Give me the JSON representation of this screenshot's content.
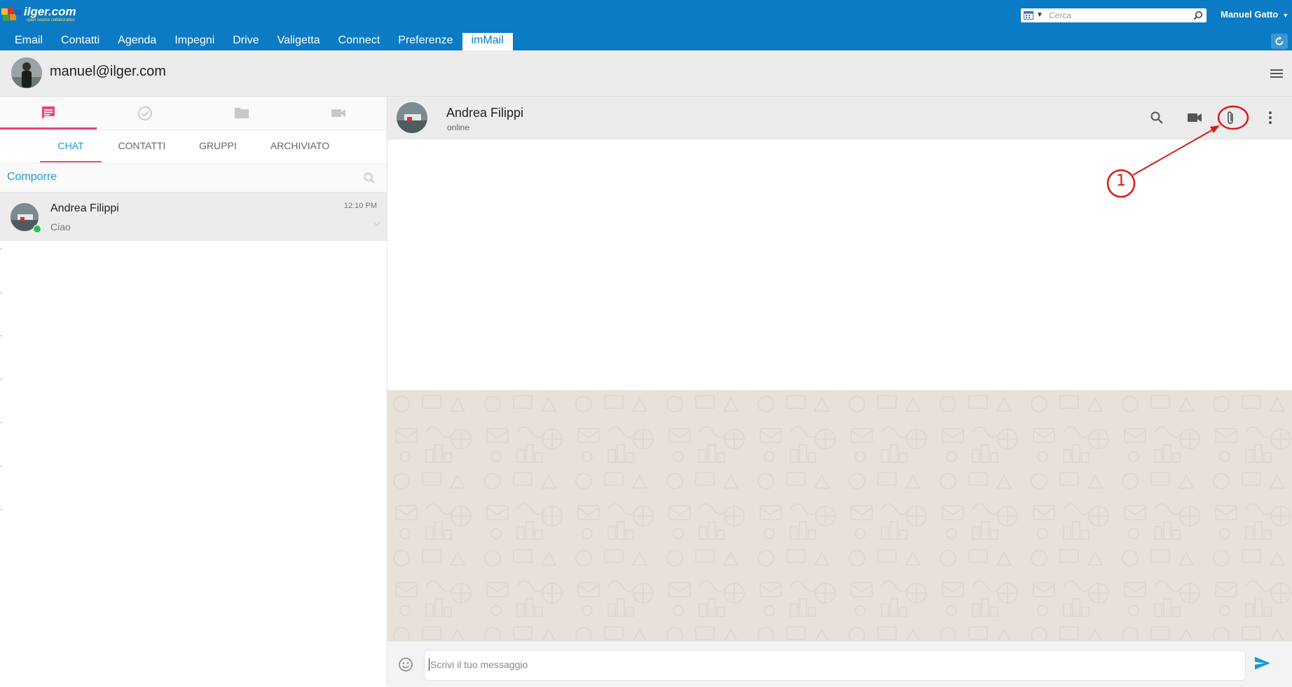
{
  "app": {
    "logo_text": "ilger.com",
    "logo_tagline": "open source collaboration"
  },
  "top_search": {
    "placeholder": "Cerca"
  },
  "user": {
    "name": "Manuel Gatto"
  },
  "nav": {
    "items": [
      {
        "label": "Email"
      },
      {
        "label": "Contatti"
      },
      {
        "label": "Agenda"
      },
      {
        "label": "Impegni"
      },
      {
        "label": "Drive"
      },
      {
        "label": "Valigetta"
      },
      {
        "label": "Connect"
      },
      {
        "label": "Preferenze"
      },
      {
        "label": "imMail"
      }
    ],
    "active": "imMail"
  },
  "profile": {
    "email": "manuel@ilger.com"
  },
  "left_panel": {
    "icon_tabs": [
      "chat-icon",
      "check-circle-icon",
      "folder-icon",
      "video-camera-icon"
    ],
    "sub_tabs": [
      {
        "label": "CHAT"
      },
      {
        "label": "CONTATTI"
      },
      {
        "label": "GRUPPI"
      },
      {
        "label": "ARCHIVIATO"
      }
    ],
    "compose_label": "Comporre",
    "chats": [
      {
        "name": "Andrea Filippi",
        "preview": "Ciao",
        "time": "12:10 PM",
        "online": true
      }
    ]
  },
  "conversation": {
    "contact_name": "Andrea Filippi",
    "status": "online",
    "header_icons": [
      "search-icon",
      "video-camera-icon",
      "paperclip-icon",
      "more-vert-icon"
    ],
    "input_placeholder": "Scrivi il tuo messaggio"
  },
  "annotation": {
    "number": "1",
    "color": "#e01818"
  },
  "colors": {
    "topbar": "#0a7bc4",
    "accent_pink": "#e8457c",
    "accent_blue": "#1a9ad8",
    "online_green": "#27c44a"
  }
}
